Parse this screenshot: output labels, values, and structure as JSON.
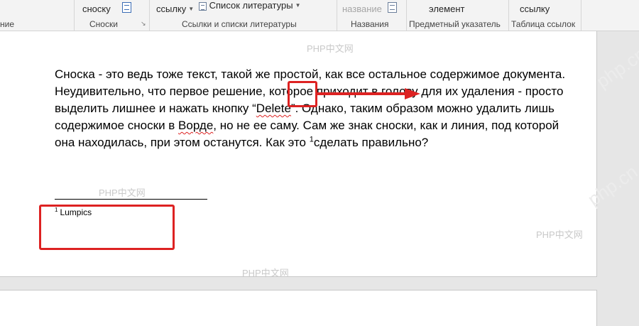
{
  "ribbon": {
    "partial_left_caption": "ние",
    "footnote_button": "сноску",
    "footnotes_group": "Сноски",
    "insert_link_button": "ссылку",
    "bibliography_button": "Список литературы",
    "citations_group": "Ссылки и списки литературы",
    "caption_button": "название",
    "captions_group": "Названия",
    "index_button": "элемент",
    "index_group": "Предметный указатель",
    "toa_button": "ссылку",
    "toa_group": "Таблица ссылок"
  },
  "document": {
    "paragraph": {
      "part1": "Сноска - это ведь тоже текст, такой же простой, как все остальное содержимое документа. Неудивительно, что первое решение, которое приходит в голову для их удаления - просто выделить лишнее и нажать кнопку “",
      "delete_word": "Delete",
      "part2": "”. Однако, таким образом можно удалить лишь содержимое сноски в ",
      "vorde_word": "Ворде",
      "part3": ", но не ее саму. Сам же знак сноски, как и линия, под которой она находилась, при этом останутся. Как это ",
      "footnote_mark": "1",
      "part4": "сделать правильно?"
    },
    "footnote": {
      "mark": "1",
      "text": "Lumpics"
    }
  },
  "watermarks": {
    "text": "PHP中文网",
    "diag": "php.cn"
  },
  "colors": {
    "annotation": "#dd2222",
    "ribbon_bg": "#f3f3f3",
    "page_bg": "#ffffff",
    "workspace_bg": "#e6e6e6"
  }
}
